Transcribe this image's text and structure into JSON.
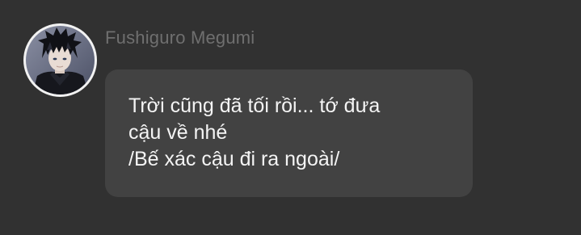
{
  "message": {
    "sender_name": "Fushiguro Megumi",
    "avatar_icon": "character-avatar-icon",
    "lines": [
      "Trời cũng đã tối rồi... tớ đưa",
      "cậu về nhé",
      "/Bế xác cậu đi ra ngoài/"
    ]
  },
  "colors": {
    "background": "#313131",
    "bubble": "#424242",
    "sender_name": "#6f6f6f",
    "message_text": "#f4f4f4"
  }
}
